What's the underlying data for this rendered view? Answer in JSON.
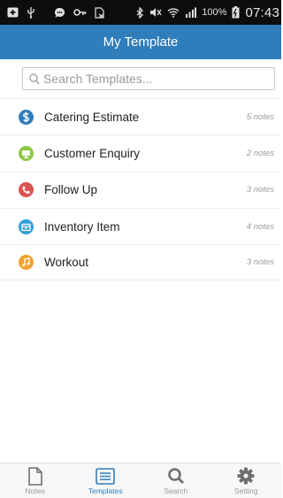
{
  "status_bar": {
    "battery": "100%",
    "time": "07:43"
  },
  "header": {
    "title": "My Template"
  },
  "search": {
    "placeholder": "Search Templates..."
  },
  "templates": [
    {
      "label": "Catering Estimate",
      "count": "5 notes",
      "icon": "dollar-icon",
      "color": "#2f7dbb"
    },
    {
      "label": "Customer Enquiry",
      "count": "2 notes",
      "icon": "monitor-icon",
      "color": "#8cc63f"
    },
    {
      "label": "Follow Up",
      "count": "3 notes",
      "icon": "phone-icon",
      "color": "#d9534f"
    },
    {
      "label": "Inventory Item",
      "count": "4 notes",
      "icon": "box-icon",
      "color": "#2f9fd8"
    },
    {
      "label": "Workout",
      "count": "3 notes",
      "icon": "music-icon",
      "color": "#f0a22e"
    }
  ],
  "bottom_nav": [
    {
      "label": "Notes",
      "icon": "notes-icon",
      "active": false
    },
    {
      "label": "Templates",
      "icon": "templates-icon",
      "active": true
    },
    {
      "label": "Search",
      "icon": "search-icon",
      "active": false
    },
    {
      "label": "Setting",
      "icon": "gear-icon",
      "active": false
    }
  ],
  "colors": {
    "accent": "#2f7dbb",
    "status_bar": "#0d0d0d",
    "inactive": "#9a9a9a"
  }
}
